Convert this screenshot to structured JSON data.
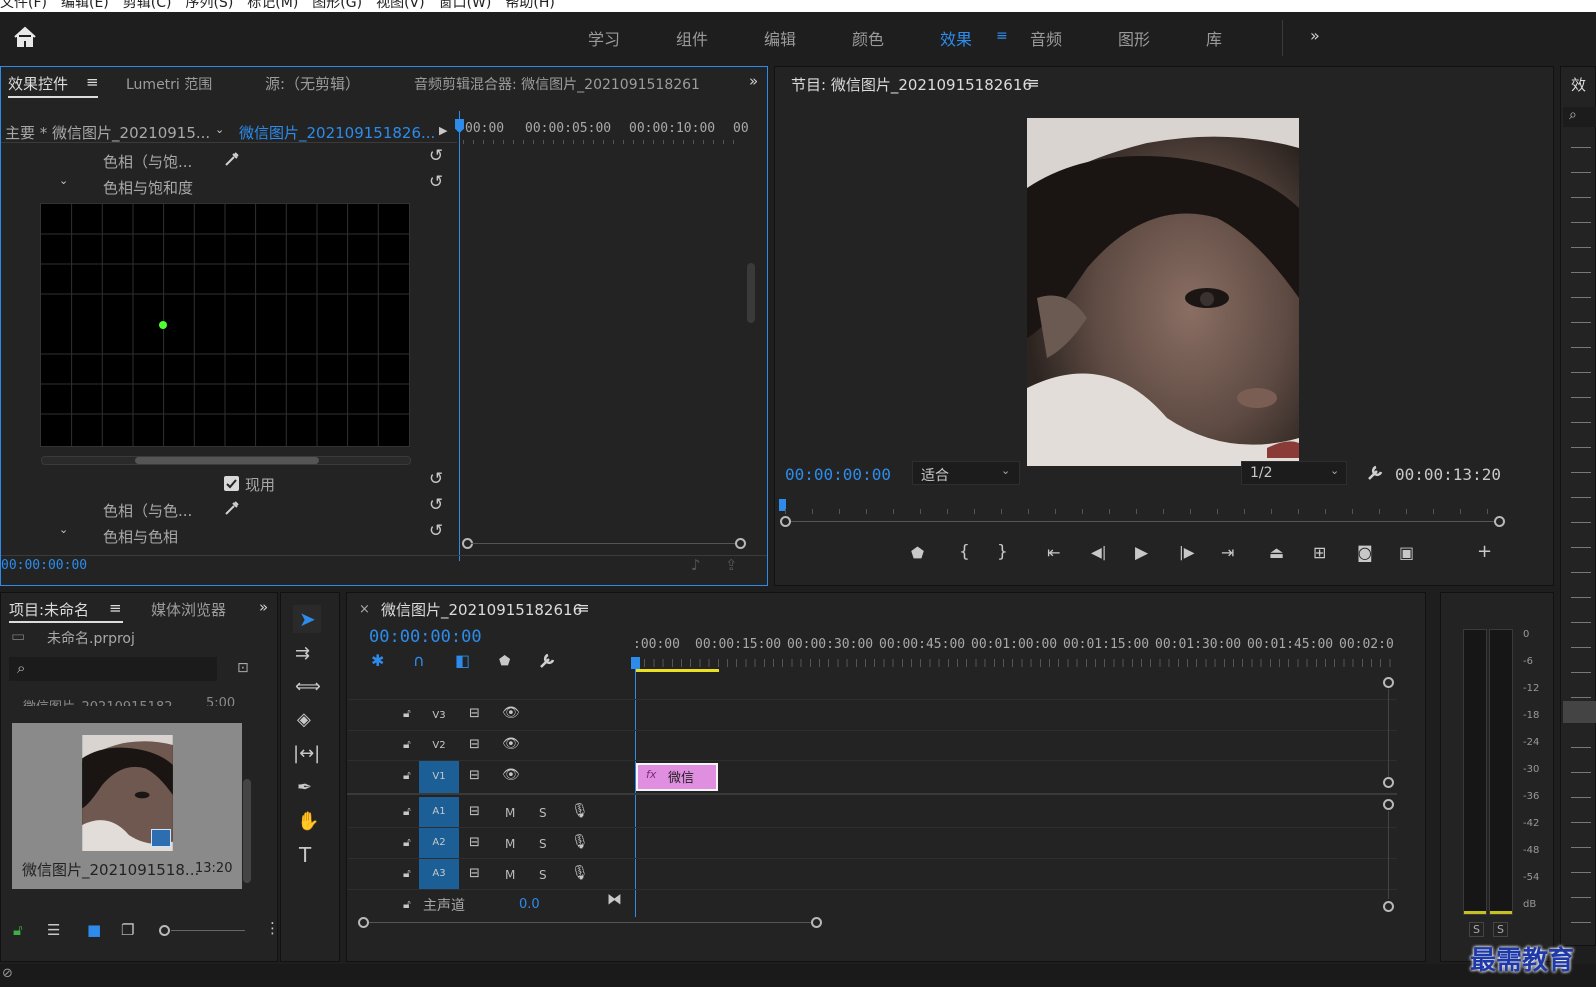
{
  "menu": [
    "文件(F)",
    "编辑(E)",
    "剪辑(C)",
    "序列(S)",
    "标记(M)",
    "图形(G)",
    "视图(V)",
    "窗口(W)",
    "帮助(H)"
  ],
  "workspaces": [
    {
      "label": "学习"
    },
    {
      "label": "组件"
    },
    {
      "label": "编辑"
    },
    {
      "label": "颜色"
    },
    {
      "label": "效果",
      "active": true
    },
    {
      "label": "音频"
    },
    {
      "label": "图形"
    },
    {
      "label": "库"
    }
  ],
  "effect_controls": {
    "tabs": [
      "效果控件",
      "Lumetri 范围",
      "源:（无剪辑）",
      "音频剪辑混合器: 微信图片_2021091518261"
    ],
    "master_clip": "主要 * 微信图片_20210915...",
    "active_clip": "微信图片_202109151826...",
    "ruler": [
      "00:00",
      "00:00:05:00",
      "00:00:10:00",
      "00"
    ],
    "rows": {
      "hue_sat_pick": "色相（与饱...",
      "hue_sat_curve": "色相与饱和度",
      "enable": "现用",
      "hue_hue_pick": "色相（与色...",
      "hue_hue_curve": "色相与色相"
    },
    "timecode": "00:00:00:00"
  },
  "program": {
    "title": "节目: 微信图片_20210915182616",
    "timecode": "00:00:00:00",
    "fit": "适合",
    "resolution": "1/2",
    "duration": "00:00:13:20"
  },
  "project": {
    "tabs": [
      "项目:未命名",
      "媒体浏览器"
    ],
    "file": "未命名.prproj",
    "search_placeholder": "",
    "item_above": "微信图片_20210915182...",
    "item_above_dur": "5:00",
    "item_name": "微信图片_2021091518...",
    "item_dur": "13:20"
  },
  "timeline": {
    "title": "微信图片_20210915182616",
    "timecode": "00:00:00:00",
    "ruler": [
      ":00:00",
      "00:00:15:00",
      "00:00:30:00",
      "00:00:45:00",
      "00:01:00:00",
      "00:01:15:00",
      "00:01:30:00",
      "00:01:45:00",
      "00:02:0"
    ],
    "video_tracks": [
      "V3",
      "V2",
      "V1"
    ],
    "audio_tracks": [
      "A1",
      "A2",
      "A3"
    ],
    "master": "主声道",
    "master_value": "0.0",
    "clip_label": "微信",
    "clip_fx": "fx",
    "mute": "M",
    "solo": "S"
  },
  "meter": {
    "scale": [
      "0",
      "-6",
      "-12",
      "-18",
      "-24",
      "-30",
      "-36",
      "-42",
      "-48",
      "-54",
      "dB"
    ],
    "solo": [
      "S",
      "S"
    ]
  },
  "right_panel": {
    "title": "效"
  },
  "watermark": "最需教育",
  "colors": {
    "accent": "#2d8ceb",
    "clip": "#e08ee0",
    "panel": "#232323",
    "bg": "#1e1e1e"
  }
}
